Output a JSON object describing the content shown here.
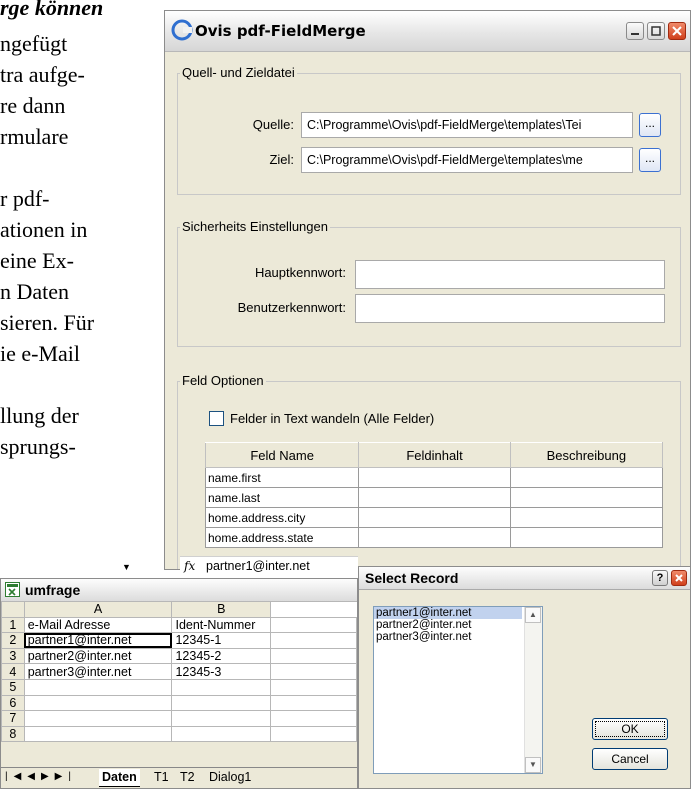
{
  "document": {
    "lines": [
      "rge können",
      "ngefügt",
      "tra aufge-",
      "re dann",
      "rmulare",
      "r pdf-",
      "ationen in",
      "eine Ex-",
      "n Daten",
      "sieren. Für",
      "ie e-Mail",
      "llung der",
      "sprungs-"
    ]
  },
  "main_window": {
    "title": "Ovis pdf-FieldMerge",
    "group_files": {
      "legend": "Quell- und Zieldatei",
      "source_label": "Quelle:",
      "source_value": "C:\\Programme\\Ovis\\pdf-FieldMerge\\templates\\Tei",
      "target_label": "Ziel:",
      "target_value": "C:\\Programme\\Ovis\\pdf-FieldMerge\\templates\\me",
      "browse_label": "..."
    },
    "group_security": {
      "legend": "Sicherheits Einstellungen",
      "master_label": "Hauptkennwort:",
      "master_value": "",
      "user_label": "Benutzerkennwort:",
      "user_value": ""
    },
    "group_fields": {
      "legend": "Feld Optionen",
      "checkbox_label": "Felder in Text wandeln (Alle Felder)",
      "columns": [
        "Feld Name",
        "Feldinhalt",
        "Beschreibung"
      ],
      "rows": [
        [
          "name.first",
          "",
          ""
        ],
        [
          "name.last",
          "",
          ""
        ],
        [
          "home.address.city",
          "",
          ""
        ],
        [
          "home.address.state",
          "",
          ""
        ]
      ]
    }
  },
  "formula_bar": {
    "fx": "fx",
    "value": "partner1@inter.net"
  },
  "spreadsheet": {
    "title": "umfrage",
    "columns": [
      "A",
      "B"
    ],
    "rows": [
      [
        "1",
        "e-Mail Adresse",
        "Ident-Nummer"
      ],
      [
        "2",
        "partner1@inter.net",
        "12345-1"
      ],
      [
        "3",
        "partner2@inter.net",
        "12345-2"
      ],
      [
        "4",
        "partner3@inter.net",
        "12345-3"
      ],
      [
        "5",
        "",
        ""
      ],
      [
        "6",
        "",
        ""
      ],
      [
        "7",
        "",
        ""
      ],
      [
        "8",
        "",
        ""
      ]
    ],
    "tabs": [
      "Daten",
      "T1",
      "T2",
      "Dialog1"
    ]
  },
  "select_record": {
    "title": "Select Record",
    "items": [
      "partner1@inter.net",
      "partner2@inter.net",
      "partner3@inter.net"
    ],
    "ok_label": "OK",
    "cancel_label": "Cancel"
  }
}
